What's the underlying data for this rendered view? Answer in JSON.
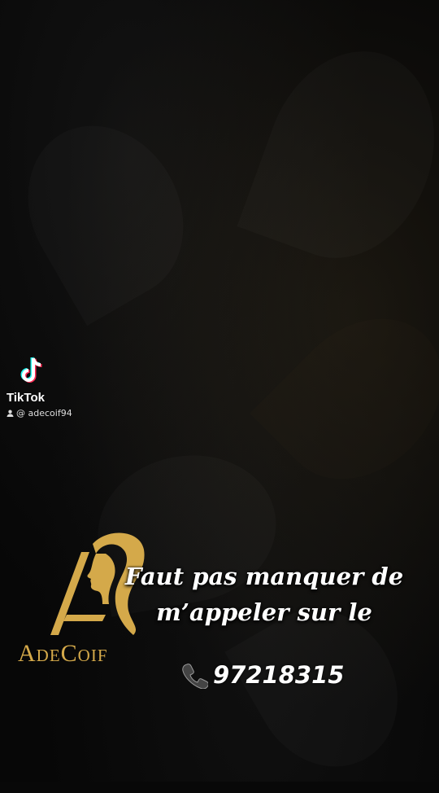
{
  "watermark": {
    "app_name": "TikTok",
    "username": "@ adecoif94"
  },
  "logo": {
    "brand_text": "AdeCoif"
  },
  "caption": {
    "line1": "Faut pas manquer de",
    "line2": "m’appeler sur le"
  },
  "phone": {
    "icon": "phone-icon",
    "number": "97218315"
  },
  "colors": {
    "gold": "#d4a94a",
    "text": "#ffffff",
    "background": "#080808"
  }
}
